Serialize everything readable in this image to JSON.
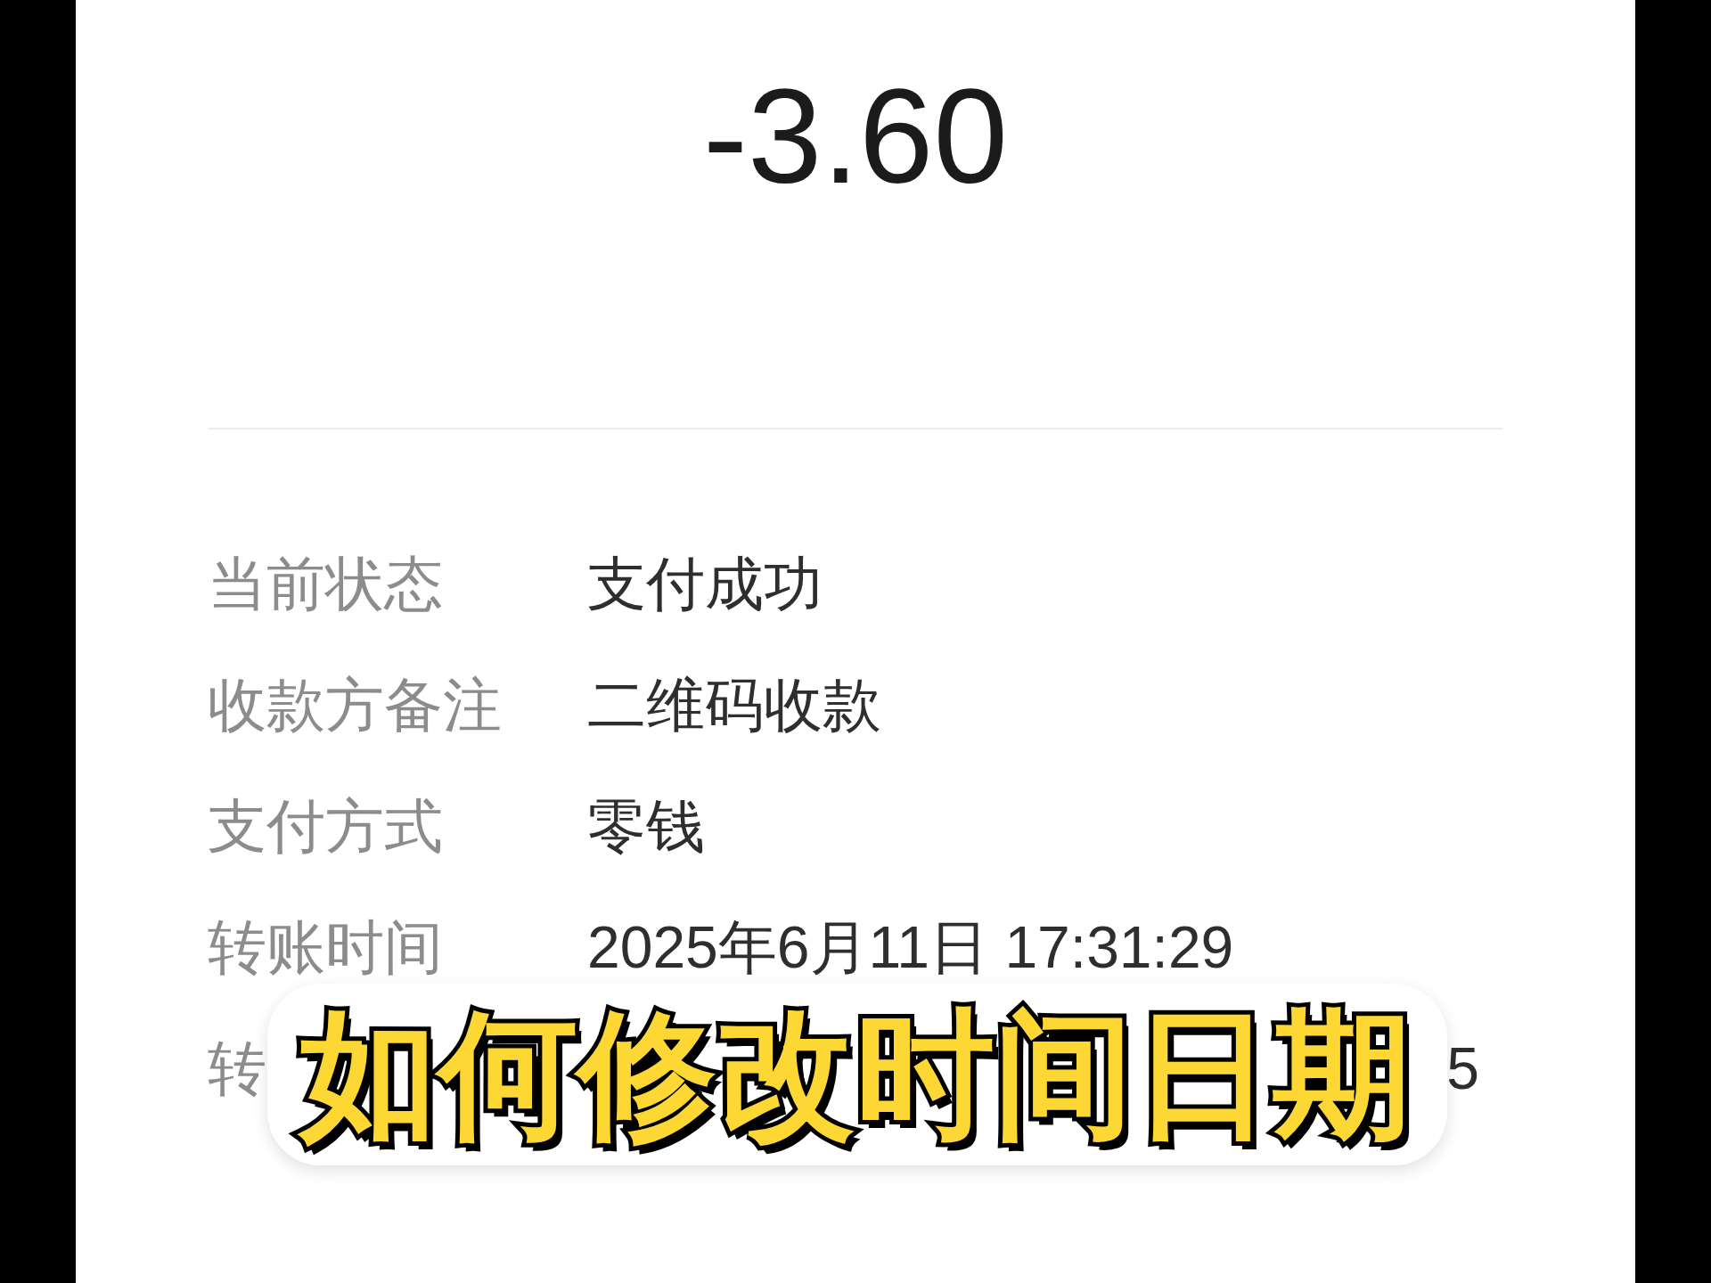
{
  "amount": "-3.60",
  "details": [
    {
      "kind": "full",
      "label": "当前状态",
      "value": "支付成功"
    },
    {
      "kind": "full",
      "label": "收款方备注",
      "value": "二维码收款"
    },
    {
      "kind": "full",
      "label": "支付方式",
      "value": "零钱"
    },
    {
      "kind": "full",
      "label": "转账时间",
      "value": "2025年6月11日 17:31:29"
    },
    {
      "kind": "partial",
      "label": "转",
      "value": "5"
    }
  ],
  "caption": "如何修改时间日期"
}
